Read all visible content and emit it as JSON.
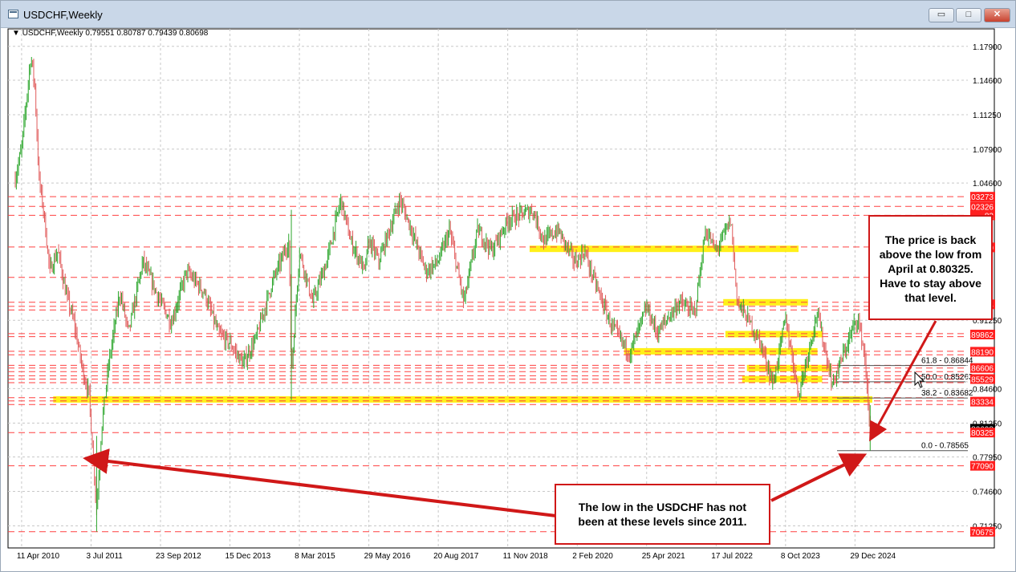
{
  "window": {
    "title": "USDCHF,Weekly",
    "buttons": {
      "minimize": "▭",
      "maximize": "□",
      "close": "✕"
    }
  },
  "header": {
    "symbol_line": "USDCHF,Weekly  0.79551 0.80787 0.79439 0.80698"
  },
  "annotations": {
    "right_callout": [
      "The price is back",
      "above the low from",
      "April at 0.80325.",
      "Have to stay above",
      "that level."
    ],
    "bottom_callout": [
      "The low in the USDCHF has not",
      "been at these levels since 2011."
    ]
  },
  "chart_data": {
    "type": "candlestick",
    "title": "USDCHF,Weekly",
    "ohlc_last": {
      "open": 0.79551,
      "high": 0.80787,
      "low": 0.79439,
      "close": 0.80698
    },
    "ylim": [
      0.691,
      1.196
    ],
    "xlabel": "",
    "ylabel": "",
    "grid": true,
    "y_ticks": [
      1.179,
      1.146,
      1.1125,
      1.079,
      1.046,
      0.9125,
      0.846,
      0.8125,
      0.7795,
      0.746,
      0.7125
    ],
    "x_ticks": [
      "11 Apr 2010",
      "3 Jul 2011",
      "23 Sep 2012",
      "15 Dec 2013",
      "8 Mar 2015",
      "29 May 2016",
      "20 Aug 2017",
      "11 Nov 2018",
      "2 Feb 2020",
      "25 Apr 2021",
      "17 Jul 2022",
      "8 Oct 2023",
      "29 Dec 2024"
    ],
    "x_range": [
      "2010-03-01",
      "2025-04-20"
    ],
    "price_tags": [
      {
        "label": "1.03273",
        "value": 1.03273,
        "color": "#ff2020"
      },
      {
        "label": "1.02326",
        "value": 1.02326,
        "color": "#ff2020"
      },
      {
        "label": "82",
        "value": 1.0146,
        "color": "#ff2020"
      },
      {
        "label": "0.98340",
        "value": 0.9834,
        "color": "#ff2020"
      },
      {
        "label": "24",
        "value": 0.928,
        "color": "#ff2020"
      },
      {
        "label": "0.89862",
        "value": 0.89862,
        "color": "#ff2020"
      },
      {
        "label": "0.88190",
        "value": 0.8819,
        "color": "#ff2020"
      },
      {
        "label": "0.86606",
        "value": 0.86606,
        "color": "#ff2020"
      },
      {
        "label": "0.85529",
        "value": 0.85529,
        "color": "#ff2020"
      },
      {
        "label": "0.83334",
        "value": 0.83334,
        "color": "#ff2020"
      },
      {
        "label": "0.80698",
        "value": 0.80698,
        "color": "#000000"
      },
      {
        "label": "0.80325",
        "value": 0.80325,
        "color": "#ff2020"
      },
      {
        "label": "0.77090",
        "value": 0.7709,
        "color": "#ff2020"
      },
      {
        "label": "0.70675",
        "value": 0.70675,
        "color": "#ff2020"
      }
    ],
    "red_lines": [
      1.03273,
      1.02326,
      1.0146,
      0.9838,
      0.9542,
      0.93,
      0.926,
      0.9225,
      0.8995,
      0.8966,
      0.8823,
      0.8789,
      0.8687,
      0.866,
      0.8625,
      0.8585,
      0.8553,
      0.8518,
      0.8372,
      0.834,
      0.8305,
      0.8032,
      0.7709,
      0.7068
    ],
    "yellow_zones": [
      {
        "from": "2019-04-01",
        "to": "2023-12-31",
        "value": 0.982
      },
      {
        "from": "2022-09-01",
        "to": "2024-03-01",
        "value": 0.93
      },
      {
        "from": "2022-09-15",
        "to": "2024-06-01",
        "value": 0.899
      },
      {
        "from": "2020-12-01",
        "to": "2024-05-01",
        "value": 0.8823
      },
      {
        "from": "2023-02-01",
        "to": "2024-08-01",
        "value": 0.866
      },
      {
        "from": "2023-01-01",
        "to": "2024-06-01",
        "value": 0.8553
      },
      {
        "from": "2010-11-01",
        "to": "2025-04-20",
        "value": 0.8355
      }
    ],
    "fibonacci": [
      {
        "label": "61.8 - 0.86844",
        "value": 0.86844
      },
      {
        "label": "50.0 - 0.85263",
        "value": 0.85263
      },
      {
        "label": "38.2 - 0.83682",
        "value": 0.83682
      },
      {
        "label": "0.0 - 0.78565",
        "value": 0.78565
      }
    ],
    "price_path": [
      [
        "2010-03-01",
        1.05
      ],
      [
        "2010-04-11",
        1.08
      ],
      [
        "2010-06-10",
        1.17
      ],
      [
        "2010-07-05",
        1.14
      ],
      [
        "2010-08-01",
        1.05
      ],
      [
        "2010-08-30",
        1.02
      ],
      [
        "2010-10-10",
        0.96
      ],
      [
        "2010-12-01",
        0.98
      ],
      [
        "2011-01-20",
        0.94
      ],
      [
        "2011-03-15",
        0.91
      ],
      [
        "2011-05-15",
        0.86
      ],
      [
        "2011-06-20",
        0.84
      ],
      [
        "2011-08-08",
        0.73
      ],
      [
        "2011-09-10",
        0.81
      ],
      [
        "2011-10-25",
        0.87
      ],
      [
        "2012-01-05",
        0.94
      ],
      [
        "2012-03-01",
        0.9
      ],
      [
        "2012-06-01",
        0.97
      ],
      [
        "2012-09-23",
        0.93
      ],
      [
        "2012-12-01",
        0.91
      ],
      [
        "2013-03-10",
        0.96
      ],
      [
        "2013-07-01",
        0.94
      ],
      [
        "2013-10-01",
        0.9
      ],
      [
        "2013-12-15",
        0.89
      ],
      [
        "2014-03-10",
        0.87
      ],
      [
        "2014-06-01",
        0.895
      ],
      [
        "2014-09-15",
        0.95
      ],
      [
        "2014-12-31",
        0.99
      ],
      [
        "2015-01-15",
        0.86
      ],
      [
        "2015-03-08",
        0.98
      ],
      [
        "2015-06-01",
        0.93
      ],
      [
        "2015-09-01",
        0.97
      ],
      [
        "2015-11-30",
        1.03
      ],
      [
        "2016-02-01",
        0.99
      ],
      [
        "2016-05-01",
        0.96
      ],
      [
        "2016-05-29",
        0.99
      ],
      [
        "2016-08-01",
        0.97
      ],
      [
        "2016-12-15",
        1.03
      ],
      [
        "2017-03-01",
        1.0
      ],
      [
        "2017-06-01",
        0.96
      ],
      [
        "2017-08-20",
        0.97
      ],
      [
        "2017-11-01",
        1.0
      ],
      [
        "2018-02-01",
        0.93
      ],
      [
        "2018-05-01",
        1.0
      ],
      [
        "2018-08-01",
        0.98
      ],
      [
        "2018-11-11",
        1.01
      ],
      [
        "2019-04-20",
        1.02
      ],
      [
        "2019-07-01",
        0.99
      ],
      [
        "2019-10-01",
        1.0
      ],
      [
        "2020-01-15",
        0.97
      ],
      [
        "2020-02-02",
        0.97
      ],
      [
        "2020-03-20",
        0.98
      ],
      [
        "2020-05-01",
        0.96
      ],
      [
        "2020-09-01",
        0.91
      ],
      [
        "2021-01-05",
        0.88
      ],
      [
        "2021-04-25",
        0.925
      ],
      [
        "2021-07-01",
        0.9
      ],
      [
        "2021-11-20",
        0.93
      ],
      [
        "2022-03-01",
        0.92
      ],
      [
        "2022-05-10",
        1.0
      ],
      [
        "2022-07-17",
        0.98
      ],
      [
        "2022-10-20",
        1.01
      ],
      [
        "2022-12-01",
        0.93
      ],
      [
        "2023-02-01",
        0.915
      ],
      [
        "2023-05-01",
        0.89
      ],
      [
        "2023-07-20",
        0.85
      ],
      [
        "2023-10-08",
        0.915
      ],
      [
        "2023-12-31",
        0.84
      ],
      [
        "2024-04-29",
        0.92
      ],
      [
        "2024-08-05",
        0.85
      ],
      [
        "2024-12-29",
        0.91
      ],
      [
        "2025-01-15",
        0.915
      ],
      [
        "2025-03-01",
        0.88
      ],
      [
        "2025-04-06",
        0.8
      ],
      [
        "2025-04-20",
        0.807
      ]
    ]
  }
}
